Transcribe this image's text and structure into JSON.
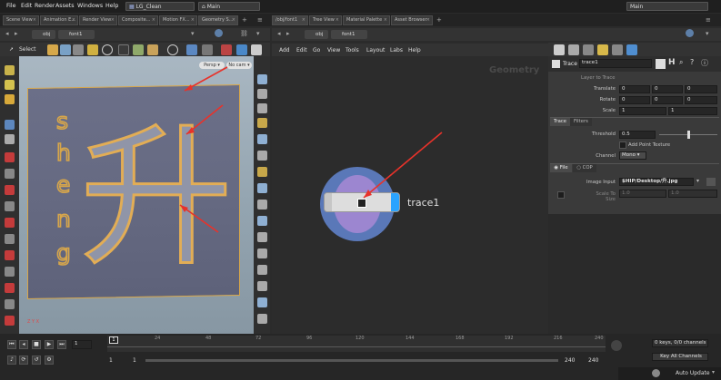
{
  "menubar": {
    "items": [
      "File",
      "Edit",
      "Render",
      "Assets",
      "Windows",
      "Help"
    ],
    "desktop": "LG_Clean",
    "context": "Main",
    "right_context": "Main"
  },
  "tabs_left": [
    "Scene View",
    "Animation E...",
    "Render View",
    "Composite...",
    "Motion FX...",
    "Geometry S..."
  ],
  "tabs_right": [
    "/obj/font1",
    "Tree View",
    "Material Palette",
    "Asset Browser"
  ],
  "left_path": {
    "obj": "obj",
    "node": "font1"
  },
  "right_path": {
    "obj": "obj",
    "node": "font1"
  },
  "viewport": {
    "select_label": "Select",
    "persp_label": "Persp",
    "cam_label": "No cam",
    "letters": [
      "s",
      "h",
      "e",
      "n",
      "g"
    ],
    "glyph": "升",
    "axis_label": "Z Y X"
  },
  "neteditor": {
    "menu": [
      "Add",
      "Edit",
      "Go",
      "View",
      "Tools",
      "Layout",
      "Labs",
      "Help"
    ],
    "watermark": "Geometry",
    "node_name": "trace1"
  },
  "params": {
    "node_type": "Trace",
    "node_name": "trace1",
    "layer": "Layer to Trace",
    "translate_label": "Translate",
    "translate": [
      "0",
      "0",
      "0"
    ],
    "rotate_label": "Rotate",
    "rotate": [
      "0",
      "0",
      "0"
    ],
    "scale_label": "Scale",
    "scale": [
      "1",
      "1"
    ],
    "tabs": [
      "Trace",
      "Filters"
    ],
    "threshold_label": "Threshold",
    "threshold_value": "0.5",
    "threshold_fraction": 0.5,
    "add_texture_label": "Add Point Texture",
    "channel_label": "Channel",
    "channel_value": "Mono",
    "source_tabs": [
      "File",
      "COP"
    ],
    "image_label": "Image Input",
    "image_value": "$HIP/Desktop/升.jpg",
    "scale_to_size_label": "Scale To Size",
    "scale_to_size": [
      "1.0",
      "1.0"
    ]
  },
  "timeline": {
    "frame": "1",
    "ticks": [
      "24",
      "48",
      "72",
      "96",
      "120",
      "144",
      "168",
      "192",
      "216",
      "240"
    ],
    "start": "1",
    "start2": "1",
    "end": "240",
    "end2": "240",
    "keys_label": "0 keys, 0/0 channels",
    "key_all_label": "Key All Channels",
    "auto_update_label": "Auto Update"
  },
  "colors": {
    "accent": "#d9a441",
    "node_ring": "#5a78b8",
    "node_inner": "#9c86d0",
    "node_flag": "#2aa3ff",
    "annotation": "#e8322a"
  }
}
